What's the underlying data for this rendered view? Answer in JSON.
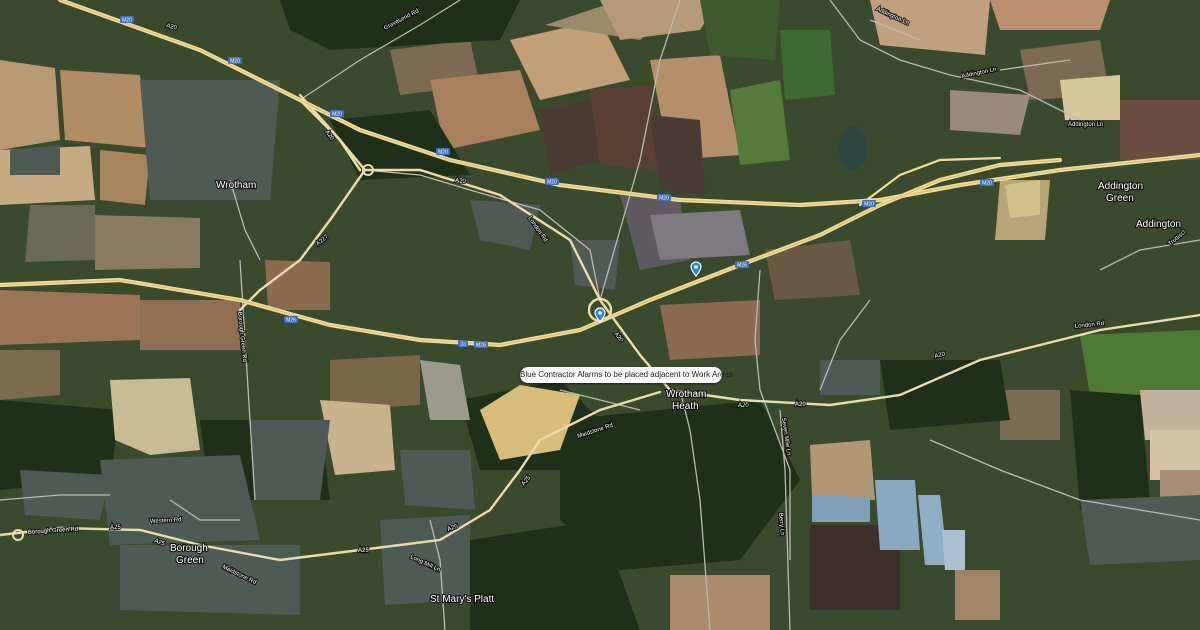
{
  "map": {
    "annotation": "Blue Contractor Alarms to be placed adjacent to Work Areas",
    "colors": {
      "motorway": "#f4e2a4",
      "a_road": "#f3e6b3",
      "minor_road": "#c9ccc4",
      "marker": "#1e88e5"
    },
    "towns": {
      "wrotham": "Wrotham",
      "wrotham_heath_1": "Wrotham",
      "wrotham_heath_2": "Heath",
      "borough_green_1": "Borough",
      "borough_green_2": "Green",
      "addington_green_1": "Addington",
      "addington_green_2": "Green",
      "addington": "Addington",
      "st_marys_platt": "St Mary's Platt",
      "trottiscliffe": "Trottiscl"
    },
    "roads": {
      "gravesend_rd": "Gravesend Rd",
      "addington_ln_1": "Addington Ln",
      "addington_ln_2": "Addington Ln",
      "addington_ln_3": "Addington Ln",
      "london_rd_1": "London Rd",
      "london_rd_2": "London Rd",
      "borough_green_rd_left": "Borough Green Rd",
      "borough_green_rd_vertical": "Borough Green Rd",
      "maidstone_rd_1": "Maidstone Rd",
      "maidstone_rd_2": "Maidstone Rd",
      "western_rd": "Western Rd",
      "long_mill_ln": "Long Mill Ln",
      "seven_mile_ln": "Seven Mile Ln",
      "berry_ln": "Berry Ln",
      "a20_1": "A20",
      "a20_2": "A20",
      "a20_3": "A20",
      "a20_4": "A20",
      "a20_5": "A20",
      "a20_6": "A20",
      "a20_7": "A20",
      "a25_1": "A25",
      "a25_2": "A25",
      "a25_3": "A25",
      "a25_4": "A25",
      "a25_5": "A25",
      "a227": "A227",
      "m20": "M20",
      "m26": "M26",
      "j2": "2a"
    }
  }
}
